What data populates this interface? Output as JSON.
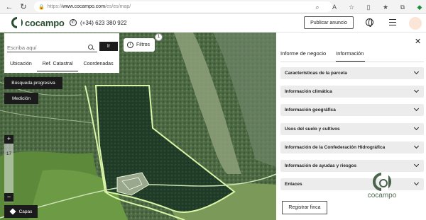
{
  "browser": {
    "url_prefix": "https://",
    "url_host": "www.cocampo.com",
    "url_path": "/es/es/map/"
  },
  "header": {
    "logo_text": "cocampo",
    "phone": "(+34) 623 380 922",
    "publish_label": "Publicar anuncio"
  },
  "search": {
    "placeholder": "Escriba aquí",
    "go_label": "Ir",
    "tabs": [
      {
        "label": "Ubicación"
      },
      {
        "label": "Ref. Catastral"
      },
      {
        "label": "Coordenadas"
      }
    ],
    "active_tab": "Ref. Catastral"
  },
  "map": {
    "filters_label": "Filtros",
    "filters_count": "1",
    "progressive_search_label": "Búsqueda progresiva",
    "measure_label": "Medición",
    "zoom_in": "+",
    "zoom_out": "−",
    "zoom_level": "17",
    "layers_label": "Capas"
  },
  "panel": {
    "tabs": [
      {
        "label": "Informe de negocio"
      },
      {
        "label": "Información"
      }
    ],
    "active_tab": "Información",
    "sections": [
      {
        "label": "Características de la parcela"
      },
      {
        "label": "Información climática"
      },
      {
        "label": "Información geográfica"
      },
      {
        "label": "Usos del suelo y cultivos"
      },
      {
        "label": "Información de la Confederación Hidrográfica"
      },
      {
        "label": "Información de ayudas y riesgos"
      },
      {
        "label": "Enlaces"
      }
    ],
    "register_label": "Registrar finca",
    "watermark_text": "cocampo"
  },
  "colors": {
    "brand": "#2b4d2f",
    "parcel_outline": "#d9f5a8",
    "dark_button": "#1b1b1b"
  }
}
